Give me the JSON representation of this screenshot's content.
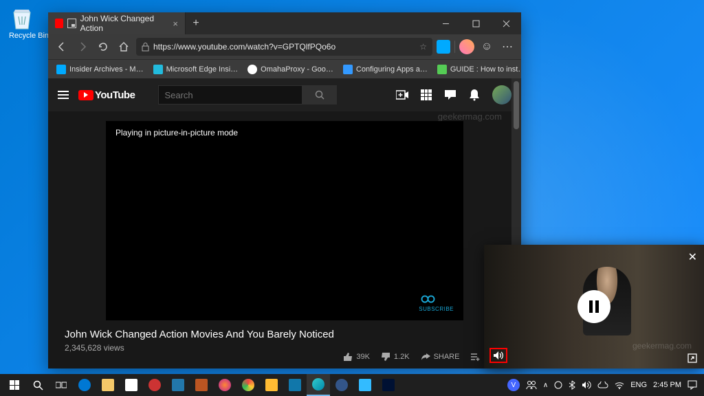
{
  "desktop": {
    "recycle_bin": "Recycle Bin"
  },
  "browser": {
    "tab_title": "John Wick Changed Action",
    "url": "https://www.youtube.com/watch?v=GPTQlfPQo6o",
    "bookmarks": [
      "Insider Archives - M…",
      "Microsoft Edge Insi…",
      "OmahaProxy - Goo…",
      "Configuring Apps a…",
      "GUIDE : How to inst…"
    ]
  },
  "youtube": {
    "logo": "YouTube",
    "search_placeholder": "Search",
    "pip_message": "Playing in picture-in-picture mode",
    "subscribe_label": "SUBSCRIBE",
    "video_title": "John Wick Changed Action Movies And You Barely Noticed",
    "views": "2,345,628 views",
    "like_count": "39K",
    "dislike_count": "1.2K",
    "share_label": "SHARE",
    "save_label": "SAVE",
    "watermark": "geekermag.com"
  },
  "pip": {
    "watermark": "geekermag.com"
  },
  "taskbar": {
    "lang": "ENG",
    "time": "2:45 PM",
    "date": "",
    "user_initial": "V"
  }
}
